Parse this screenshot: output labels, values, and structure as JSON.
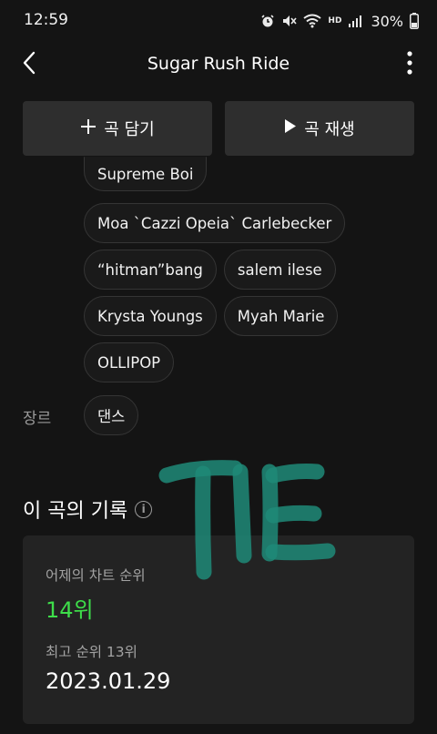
{
  "status_bar": {
    "time": "12:59",
    "hd_label": "HD",
    "battery": "30%",
    "icons": [
      "alarm-icon",
      "mute-icon",
      "wifi-icon",
      "hd-voice-icon",
      "signal-icon",
      "battery-icon"
    ]
  },
  "app_bar": {
    "title": "Sugar Rush Ride",
    "back_icon": "chevron-left-icon",
    "more_icon": "more-vertical-icon"
  },
  "actions": {
    "add_label": "곡 담기",
    "add_icon": "plus-icon",
    "play_label": "곡 재생",
    "play_icon": "play-icon"
  },
  "credits": {
    "chips": [
      [
        "Supreme Boi"
      ],
      [
        "Moa `Cazzi Opeia` Carlebecker"
      ],
      [
        "“hitman”bang",
        "salem ilese"
      ],
      [
        "Krysta Youngs",
        "Myah Marie"
      ],
      [
        "OLLIPOP"
      ]
    ]
  },
  "genre": {
    "label": "장르",
    "value": "댄스"
  },
  "record": {
    "title": "이 곡의 기록",
    "info_icon": "info-icon",
    "yesterday_label": "어제의 차트 순위",
    "yesterday_rank": "14위",
    "best_label": "최고 순위 13위",
    "best_date": "2023.01.29"
  },
  "colors": {
    "background": "#141414",
    "button": "#2e2e2e",
    "card": "#232323",
    "rank_green": "#3ede4a",
    "scribble": "#1f8a78"
  }
}
